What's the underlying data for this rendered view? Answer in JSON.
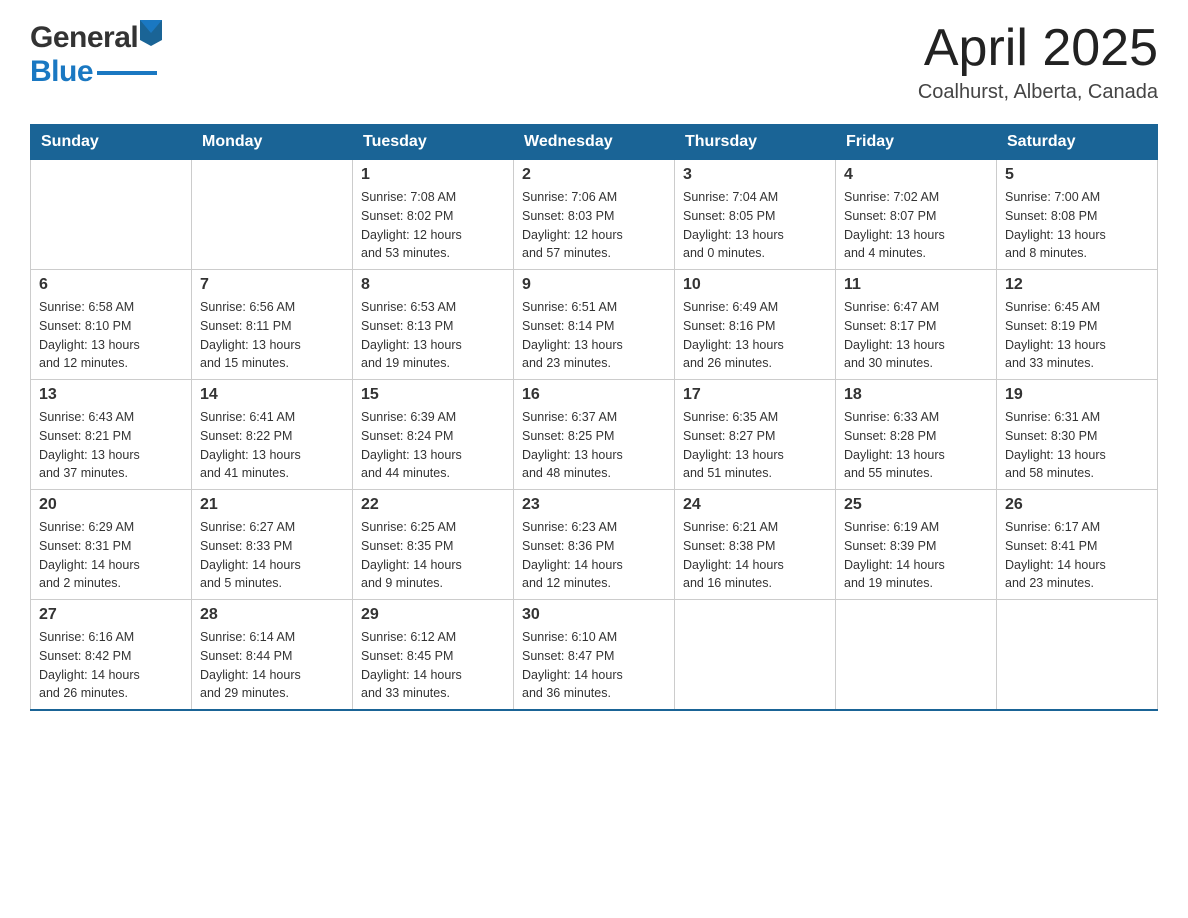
{
  "header": {
    "logo_general": "General",
    "logo_blue": "Blue",
    "month_title": "April 2025",
    "location": "Coalhurst, Alberta, Canada"
  },
  "calendar": {
    "days_of_week": [
      "Sunday",
      "Monday",
      "Tuesday",
      "Wednesday",
      "Thursday",
      "Friday",
      "Saturday"
    ],
    "weeks": [
      [
        {
          "day": "",
          "info": ""
        },
        {
          "day": "",
          "info": ""
        },
        {
          "day": "1",
          "info": "Sunrise: 7:08 AM\nSunset: 8:02 PM\nDaylight: 12 hours\nand 53 minutes."
        },
        {
          "day": "2",
          "info": "Sunrise: 7:06 AM\nSunset: 8:03 PM\nDaylight: 12 hours\nand 57 minutes."
        },
        {
          "day": "3",
          "info": "Sunrise: 7:04 AM\nSunset: 8:05 PM\nDaylight: 13 hours\nand 0 minutes."
        },
        {
          "day": "4",
          "info": "Sunrise: 7:02 AM\nSunset: 8:07 PM\nDaylight: 13 hours\nand 4 minutes."
        },
        {
          "day": "5",
          "info": "Sunrise: 7:00 AM\nSunset: 8:08 PM\nDaylight: 13 hours\nand 8 minutes."
        }
      ],
      [
        {
          "day": "6",
          "info": "Sunrise: 6:58 AM\nSunset: 8:10 PM\nDaylight: 13 hours\nand 12 minutes."
        },
        {
          "day": "7",
          "info": "Sunrise: 6:56 AM\nSunset: 8:11 PM\nDaylight: 13 hours\nand 15 minutes."
        },
        {
          "day": "8",
          "info": "Sunrise: 6:53 AM\nSunset: 8:13 PM\nDaylight: 13 hours\nand 19 minutes."
        },
        {
          "day": "9",
          "info": "Sunrise: 6:51 AM\nSunset: 8:14 PM\nDaylight: 13 hours\nand 23 minutes."
        },
        {
          "day": "10",
          "info": "Sunrise: 6:49 AM\nSunset: 8:16 PM\nDaylight: 13 hours\nand 26 minutes."
        },
        {
          "day": "11",
          "info": "Sunrise: 6:47 AM\nSunset: 8:17 PM\nDaylight: 13 hours\nand 30 minutes."
        },
        {
          "day": "12",
          "info": "Sunrise: 6:45 AM\nSunset: 8:19 PM\nDaylight: 13 hours\nand 33 minutes."
        }
      ],
      [
        {
          "day": "13",
          "info": "Sunrise: 6:43 AM\nSunset: 8:21 PM\nDaylight: 13 hours\nand 37 minutes."
        },
        {
          "day": "14",
          "info": "Sunrise: 6:41 AM\nSunset: 8:22 PM\nDaylight: 13 hours\nand 41 minutes."
        },
        {
          "day": "15",
          "info": "Sunrise: 6:39 AM\nSunset: 8:24 PM\nDaylight: 13 hours\nand 44 minutes."
        },
        {
          "day": "16",
          "info": "Sunrise: 6:37 AM\nSunset: 8:25 PM\nDaylight: 13 hours\nand 48 minutes."
        },
        {
          "day": "17",
          "info": "Sunrise: 6:35 AM\nSunset: 8:27 PM\nDaylight: 13 hours\nand 51 minutes."
        },
        {
          "day": "18",
          "info": "Sunrise: 6:33 AM\nSunset: 8:28 PM\nDaylight: 13 hours\nand 55 minutes."
        },
        {
          "day": "19",
          "info": "Sunrise: 6:31 AM\nSunset: 8:30 PM\nDaylight: 13 hours\nand 58 minutes."
        }
      ],
      [
        {
          "day": "20",
          "info": "Sunrise: 6:29 AM\nSunset: 8:31 PM\nDaylight: 14 hours\nand 2 minutes."
        },
        {
          "day": "21",
          "info": "Sunrise: 6:27 AM\nSunset: 8:33 PM\nDaylight: 14 hours\nand 5 minutes."
        },
        {
          "day": "22",
          "info": "Sunrise: 6:25 AM\nSunset: 8:35 PM\nDaylight: 14 hours\nand 9 minutes."
        },
        {
          "day": "23",
          "info": "Sunrise: 6:23 AM\nSunset: 8:36 PM\nDaylight: 14 hours\nand 12 minutes."
        },
        {
          "day": "24",
          "info": "Sunrise: 6:21 AM\nSunset: 8:38 PM\nDaylight: 14 hours\nand 16 minutes."
        },
        {
          "day": "25",
          "info": "Sunrise: 6:19 AM\nSunset: 8:39 PM\nDaylight: 14 hours\nand 19 minutes."
        },
        {
          "day": "26",
          "info": "Sunrise: 6:17 AM\nSunset: 8:41 PM\nDaylight: 14 hours\nand 23 minutes."
        }
      ],
      [
        {
          "day": "27",
          "info": "Sunrise: 6:16 AM\nSunset: 8:42 PM\nDaylight: 14 hours\nand 26 minutes."
        },
        {
          "day": "28",
          "info": "Sunrise: 6:14 AM\nSunset: 8:44 PM\nDaylight: 14 hours\nand 29 minutes."
        },
        {
          "day": "29",
          "info": "Sunrise: 6:12 AM\nSunset: 8:45 PM\nDaylight: 14 hours\nand 33 minutes."
        },
        {
          "day": "30",
          "info": "Sunrise: 6:10 AM\nSunset: 8:47 PM\nDaylight: 14 hours\nand 36 minutes."
        },
        {
          "day": "",
          "info": ""
        },
        {
          "day": "",
          "info": ""
        },
        {
          "day": "",
          "info": ""
        }
      ]
    ]
  }
}
